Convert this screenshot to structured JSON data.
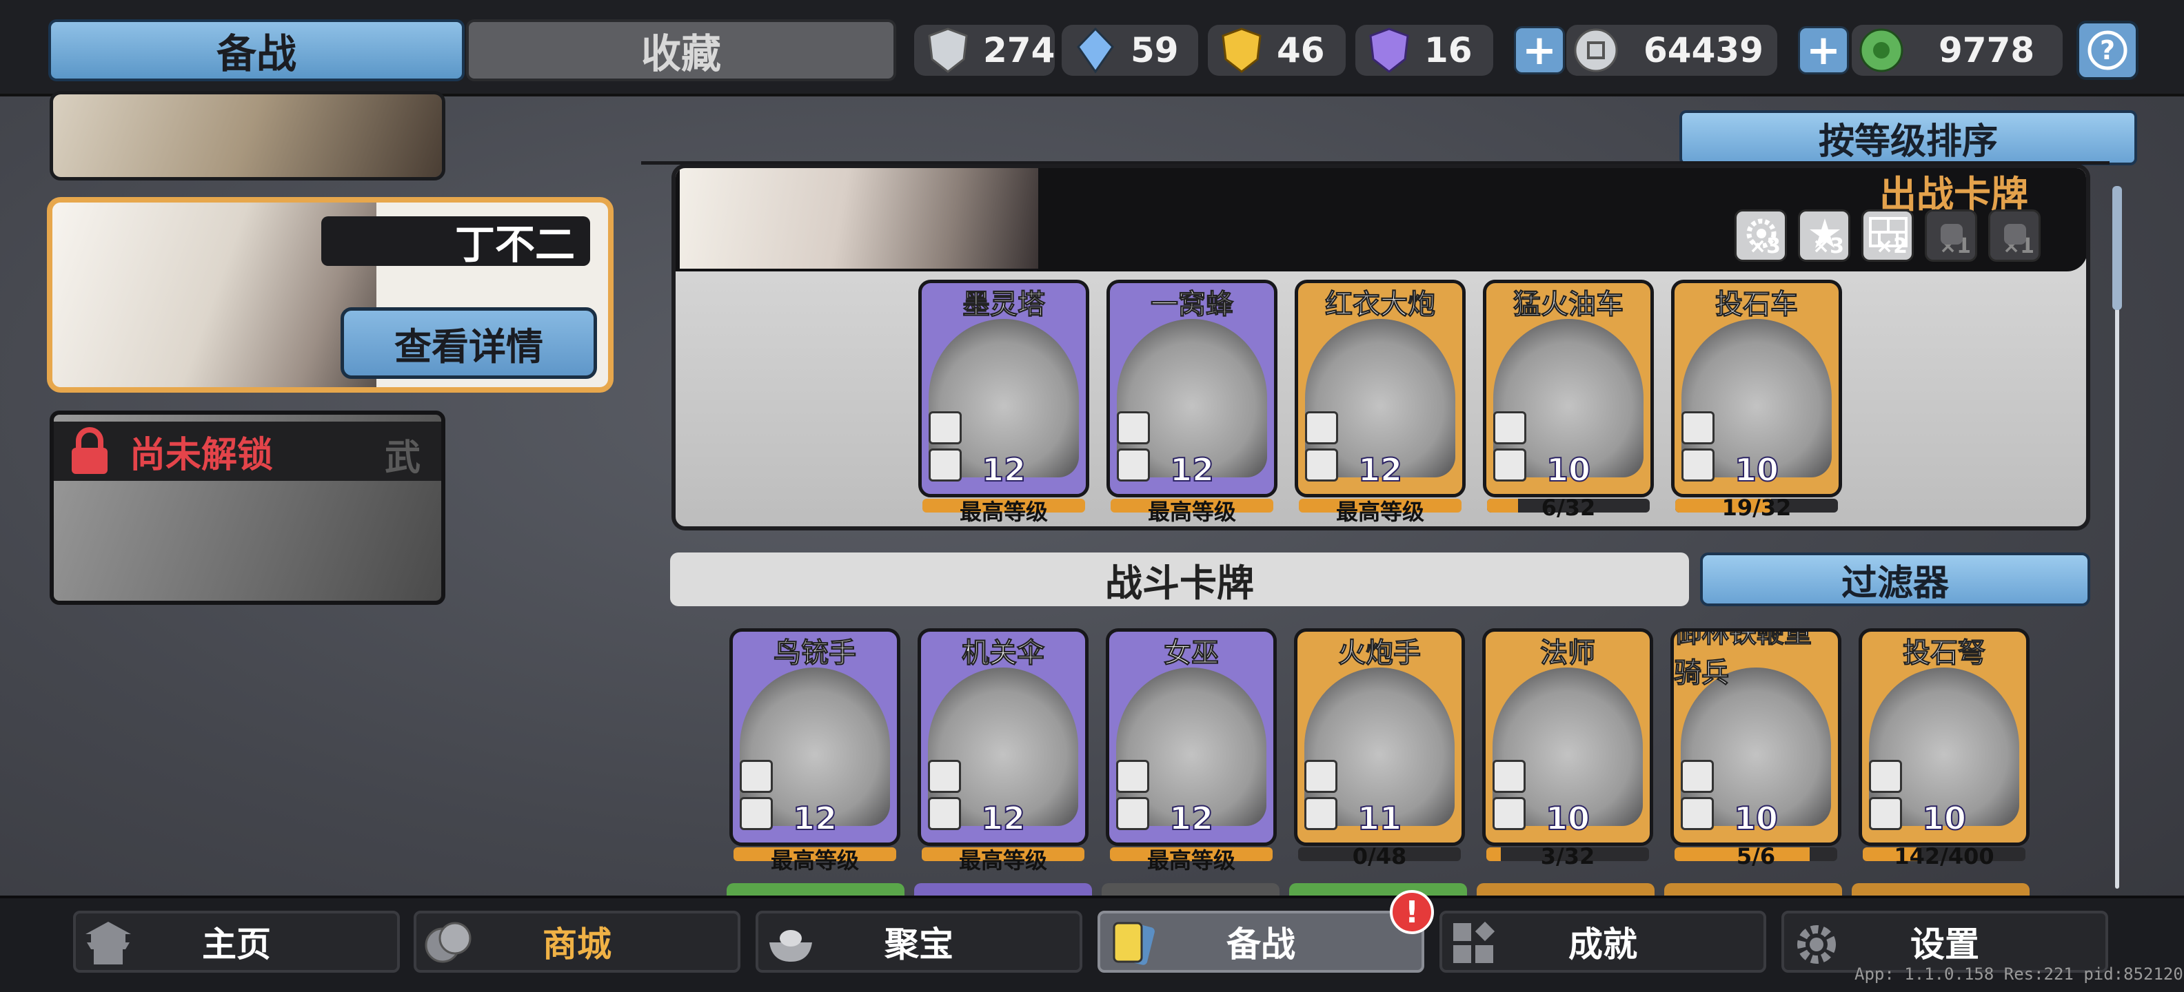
{
  "tabs": {
    "prepare": "备战",
    "collect": "收藏"
  },
  "resources": [
    {
      "icon": "silver-shield-icon",
      "value": "274"
    },
    {
      "icon": "blue-crystal-icon",
      "value": "59"
    },
    {
      "icon": "gold-shield-icon",
      "value": "46"
    },
    {
      "icon": "purple-shield-icon",
      "value": "16"
    }
  ],
  "currency": [
    {
      "icon": "silver-coin-icon",
      "value": "64439"
    },
    {
      "icon": "jade-coin-icon",
      "value": "9778"
    }
  ],
  "help_label": "?",
  "hero": {
    "name": "丁不二",
    "details_button": "查看详情"
  },
  "locked_hero": {
    "label": "尚未解锁",
    "tag": "武"
  },
  "sort_button": "按等级排序",
  "deck": {
    "title": "出战卡牌",
    "slots": [
      {
        "icon": "gear-slot-icon",
        "count": "×3",
        "active": true
      },
      {
        "icon": "burst-slot-icon",
        "count": "×3",
        "active": true
      },
      {
        "icon": "brick-slot-icon",
        "count": "×2",
        "active": true
      },
      {
        "icon": "fist-slot-icon",
        "count": "×1",
        "active": false
      },
      {
        "icon": "fist-slot-icon",
        "count": "×1",
        "active": false
      }
    ],
    "cards": [
      {
        "name": "墨灵塔",
        "level": "12",
        "sub": "最高等级",
        "color": "purple",
        "progress": 1.0
      },
      {
        "name": "一窝蜂",
        "level": "12",
        "sub": "最高等级",
        "color": "purple",
        "progress": 1.0
      },
      {
        "name": "红衣大炮",
        "level": "12",
        "sub": "最高等级",
        "color": "orange",
        "progress": 1.0
      },
      {
        "name": "猛火油车",
        "level": "10",
        "sub": "6/32",
        "color": "orange",
        "progress": 0.19
      },
      {
        "name": "投石车",
        "level": "10",
        "sub": "19/32",
        "color": "orange",
        "progress": 0.59
      }
    ]
  },
  "battle_cards_label": "战斗卡牌",
  "filter_button": "过滤器",
  "battle_cards": [
    {
      "name": "鸟铳手",
      "level": "12",
      "sub": "最高等级",
      "color": "purple",
      "progress": 1.0
    },
    {
      "name": "机关伞",
      "level": "12",
      "sub": "最高等级",
      "color": "purple",
      "progress": 1.0
    },
    {
      "name": "女巫",
      "level": "12",
      "sub": "最高等级",
      "color": "purple",
      "progress": 1.0
    },
    {
      "name": "火炮手",
      "level": "11",
      "sub": "0/48",
      "color": "orange",
      "progress": 0.0
    },
    {
      "name": "法师",
      "level": "10",
      "sub": "3/32",
      "color": "orange",
      "progress": 0.09
    },
    {
      "name": "御林铁鞭重骑兵",
      "level": "10",
      "sub": "5/6",
      "color": "orange",
      "progress": 0.83
    },
    {
      "name": "投石弩",
      "level": "10",
      "sub": "142/400",
      "color": "orange",
      "progress": 0.36
    }
  ],
  "nav": [
    {
      "label": "主页",
      "icon": "pagoda-icon"
    },
    {
      "label": "商城",
      "icon": "coins-icon"
    },
    {
      "label": "聚宝",
      "icon": "treasure-bowl-icon"
    },
    {
      "label": "备战",
      "icon": "cards-icon"
    },
    {
      "label": "成就",
      "icon": "achievements-icon"
    },
    {
      "label": "设置",
      "icon": "gear-icon"
    }
  ],
  "nav_alert": "!",
  "version": "App: 1.1.0.158 Res:221 pid:852120"
}
